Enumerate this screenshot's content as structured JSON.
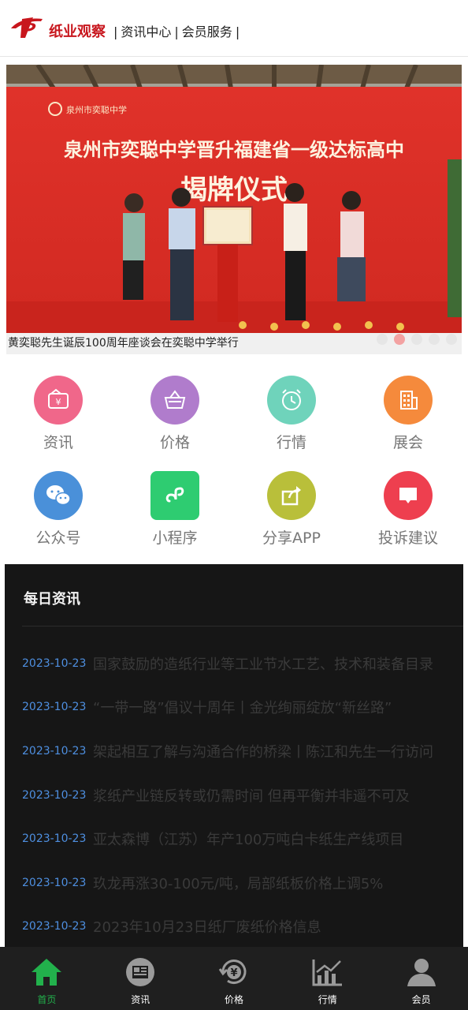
{
  "header": {
    "brand": "纸业观察",
    "nav": [
      "资讯中心",
      "会员服务"
    ]
  },
  "banner": {
    "caption": "黄奕聪先生诞辰100周年座谈会在奕聪中学举行",
    "photo_text_top": "泉州市奕聪中学晋升福建省一级达标高中",
    "photo_text_sub": "揭牌仪式",
    "dots": 5,
    "active_dot": 2
  },
  "grid": [
    {
      "label": "资讯",
      "icon": "news-icon",
      "color": "#f0678a"
    },
    {
      "label": "价格",
      "icon": "basket-icon",
      "color": "#b07ccc"
    },
    {
      "label": "行情",
      "icon": "alarm-clock-icon",
      "color": "#6fd3bb"
    },
    {
      "label": "展会",
      "icon": "building-icon",
      "color": "#f58a3c"
    },
    {
      "label": "公众号",
      "icon": "wechat-icon",
      "color": "#4a90d9"
    },
    {
      "label": "小程序",
      "icon": "mini-program-icon",
      "color": "#2ecc71"
    },
    {
      "label": "分享APP",
      "icon": "share-icon",
      "color": "#b9bf3a"
    },
    {
      "label": "投诉建议",
      "icon": "message-icon",
      "color": "#ee3f4f"
    }
  ],
  "news": {
    "title": "每日资讯",
    "items": [
      {
        "date": "2023-10-23",
        "text": "国家鼓励的造纸行业等工业节水工艺、技术和装备目录"
      },
      {
        "date": "2023-10-23",
        "text": "“一带一路”倡议十周年丨金光绚丽绽放“新丝路”"
      },
      {
        "date": "2023-10-23",
        "text": "架起相互了解与沟通合作的桥梁丨陈江和先生一行访问"
      },
      {
        "date": "2023-10-23",
        "text": "浆纸产业链反转或仍需时间 但再平衡并非遥不可及"
      },
      {
        "date": "2023-10-23",
        "text": "亚太森博（江苏）年产100万吨白卡纸生产线项目"
      },
      {
        "date": "2023-10-23",
        "text": "玖龙再涨30-100元/吨，局部纸板价格上调5%"
      },
      {
        "date": "2023-10-23",
        "text": "2023年10月23日纸厂废纸价格信息"
      }
    ]
  },
  "tabbar": [
    {
      "label": "首页",
      "icon": "home-icon",
      "active": true
    },
    {
      "label": "资讯",
      "icon": "newspaper-icon",
      "active": false
    },
    {
      "label": "价格",
      "icon": "yuan-cycle-icon",
      "active": false
    },
    {
      "label": "行情",
      "icon": "trend-chart-icon",
      "active": false
    },
    {
      "label": "会员",
      "icon": "user-icon",
      "active": false
    }
  ],
  "colors": {
    "brand_red": "#c8161d",
    "accent_green": "#22b14c",
    "date_blue": "#4e8fe0"
  }
}
